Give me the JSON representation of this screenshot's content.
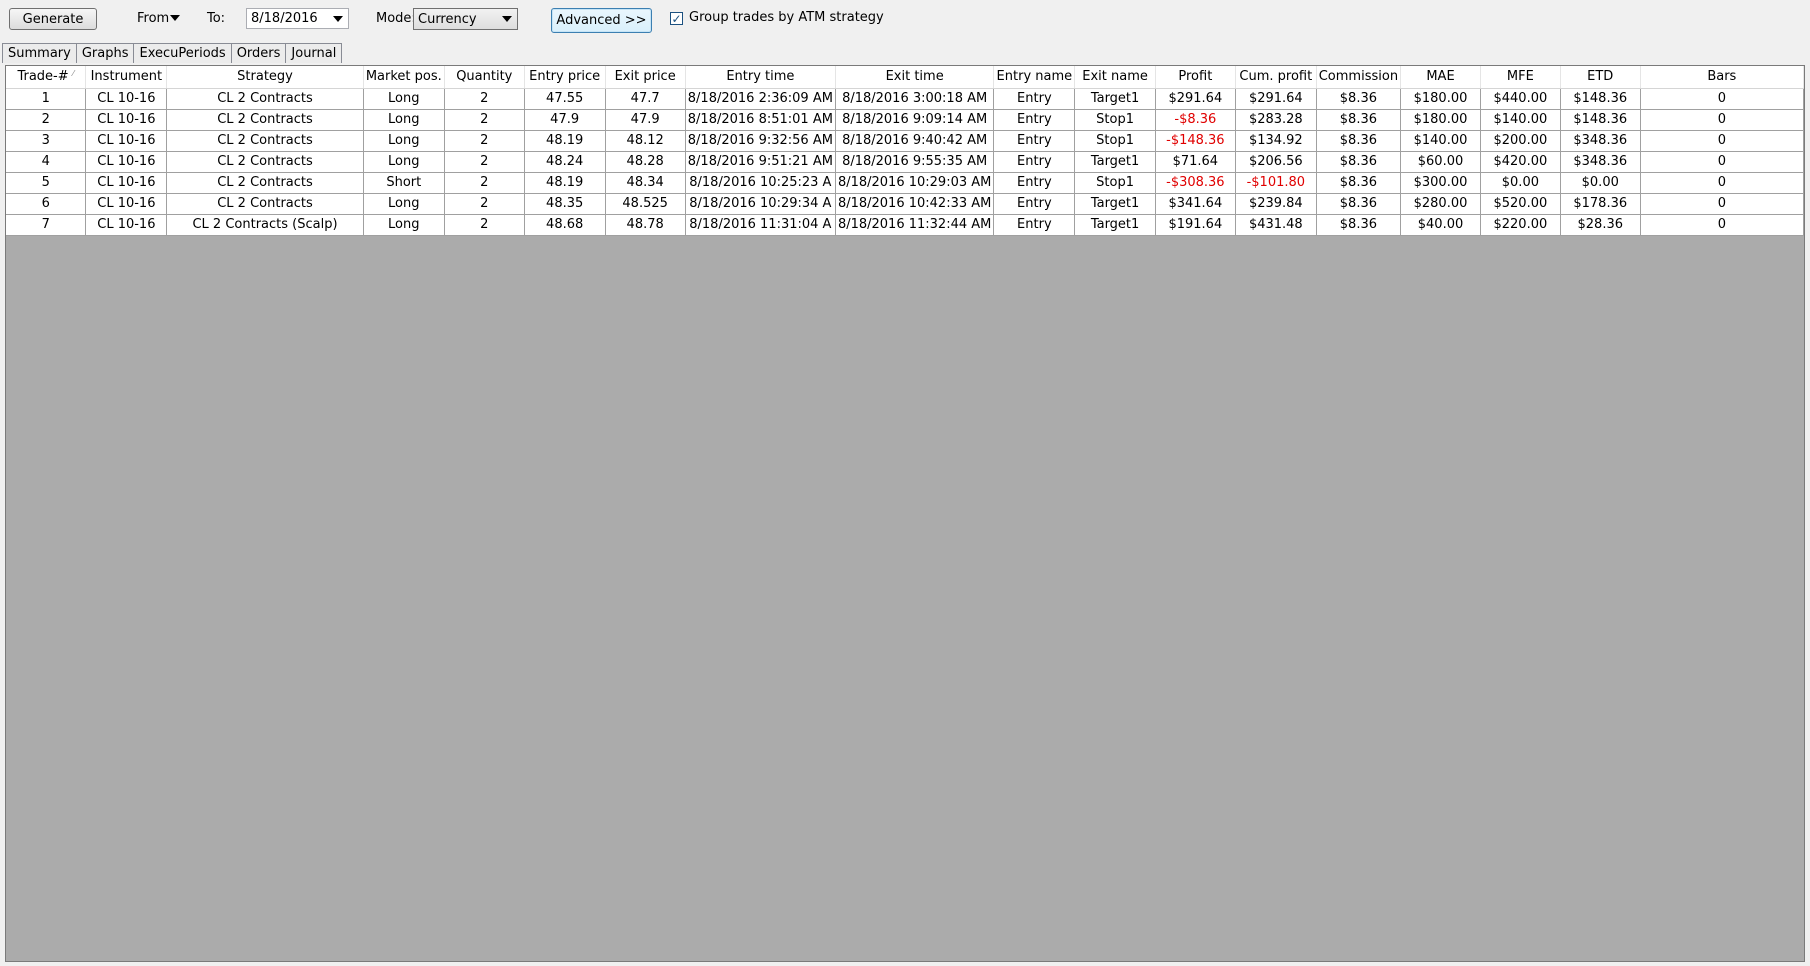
{
  "toolbar": {
    "generate_label": "Generate",
    "from_label": "From",
    "to_label": "To:",
    "to_value": "8/18/2016",
    "mode_label": "Mode:",
    "mode_value": "Currency",
    "advanced_label": "Advanced >>",
    "group_checkbox_label": "Group trades by ATM strategy",
    "group_checked": true
  },
  "tabs": [
    "Summary",
    "Graphs",
    "ExecuPeriods",
    "Orders",
    "Journal"
  ],
  "table": {
    "columns": [
      "Trade-#",
      "Instrument",
      "Strategy",
      "Market pos.",
      "Quantity",
      "Entry price",
      "Exit price",
      "Entry time",
      "Exit time",
      "Entry name",
      "Exit name",
      "Profit",
      "Cum. profit",
      "Commission",
      "MAE",
      "MFE",
      "ETD",
      "Bars"
    ],
    "rows": [
      [
        "1",
        "CL 10-16",
        "CL 2 Contracts",
        "Long",
        "2",
        "47.55",
        "47.7",
        "8/18/2016 2:36:09 AM",
        "8/18/2016 3:00:18 AM",
        "Entry",
        "Target1",
        "$291.64",
        "$291.64",
        "$8.36",
        "$180.00",
        "$440.00",
        "$148.36",
        "0"
      ],
      [
        "2",
        "CL 10-16",
        "CL 2 Contracts",
        "Long",
        "2",
        "47.9",
        "47.9",
        "8/18/2016 8:51:01 AM",
        "8/18/2016 9:09:14 AM",
        "Entry",
        "Stop1",
        "-$8.36",
        "$283.28",
        "$8.36",
        "$180.00",
        "$140.00",
        "$148.36",
        "0"
      ],
      [
        "3",
        "CL 10-16",
        "CL 2 Contracts",
        "Long",
        "2",
        "48.19",
        "48.12",
        "8/18/2016 9:32:56 AM",
        "8/18/2016 9:40:42 AM",
        "Entry",
        "Stop1",
        "-$148.36",
        "$134.92",
        "$8.36",
        "$140.00",
        "$200.00",
        "$348.36",
        "0"
      ],
      [
        "4",
        "CL 10-16",
        "CL 2 Contracts",
        "Long",
        "2",
        "48.24",
        "48.28",
        "8/18/2016 9:51:21 AM",
        "8/18/2016 9:55:35 AM",
        "Entry",
        "Target1",
        "$71.64",
        "$206.56",
        "$8.36",
        "$60.00",
        "$420.00",
        "$348.36",
        "0"
      ],
      [
        "5",
        "CL 10-16",
        "CL 2 Contracts",
        "Short",
        "2",
        "48.19",
        "48.34",
        "8/18/2016 10:25:23 A",
        "8/18/2016 10:29:03 AM",
        "Entry",
        "Stop1",
        "-$308.36",
        "-$101.80",
        "$8.36",
        "$300.00",
        "$0.00",
        "$0.00",
        "0"
      ],
      [
        "6",
        "CL 10-16",
        "CL 2 Contracts",
        "Long",
        "2",
        "48.35",
        "48.525",
        "8/18/2016 10:29:34 A",
        "8/18/2016 10:42:33 AM",
        "Entry",
        "Target1",
        "$341.64",
        "$239.84",
        "$8.36",
        "$280.00",
        "$520.00",
        "$178.36",
        "0"
      ],
      [
        "7",
        "CL 10-16",
        "CL 2 Contracts (Scalp)",
        "Long",
        "2",
        "48.68",
        "48.78",
        "8/18/2016 11:31:04 A",
        "8/18/2016 11:32:44 AM",
        "Entry",
        "Target1",
        "$191.64",
        "$431.48",
        "$8.36",
        "$40.00",
        "$220.00",
        "$28.36",
        "0"
      ]
    ]
  },
  "colors": {
    "negative": "#e00000",
    "empty_area": "#ababab"
  }
}
